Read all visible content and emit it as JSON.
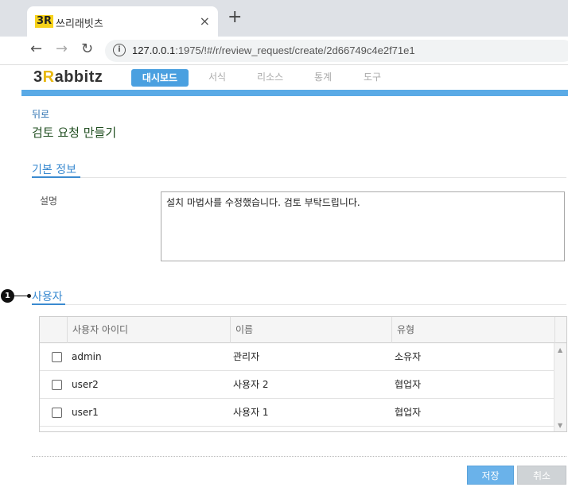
{
  "browser": {
    "favicon_text": "3R",
    "tab_title": "쓰리래빗츠",
    "tab_close": "×",
    "new_tab": "+",
    "back": "←",
    "forward": "→",
    "reload": "↻",
    "info_glyph": "i",
    "url_host": "127.0.0.1",
    "url_rest": ":1975/!#/r/review_request/create/2d66749c4e2f71e1"
  },
  "app": {
    "logo_3": "3",
    "logo_r": "R",
    "logo_rest": "abbitz",
    "nav": [
      "대시보드",
      "서식",
      "리소스",
      "통계",
      "도구"
    ],
    "active_color": "#4aa0e0",
    "accent_color": "#5aaae6"
  },
  "page": {
    "back_link": "뒤로",
    "title": "검토 요청 만들기"
  },
  "basic_info": {
    "section_title": "기본 정보",
    "description_label": "설명",
    "description_value": "설치 마법사를 수정했습니다. 검토 부탁드립니다."
  },
  "users": {
    "marker_number": "1",
    "section_title": "사용자",
    "columns": [
      "사용자 아이디",
      "이름",
      "유형"
    ],
    "rows": [
      {
        "id": "admin",
        "name": "관리자",
        "type": "소유자",
        "checked": false
      },
      {
        "id": "user2",
        "name": "사용자 2",
        "type": "협업자",
        "checked": false
      },
      {
        "id": "user1",
        "name": "사용자 1",
        "type": "협업자",
        "checked": false
      }
    ],
    "scroll_up": "▲",
    "scroll_down": "▼"
  },
  "actions": {
    "save_label": "저장",
    "cancel_label": "취소"
  }
}
